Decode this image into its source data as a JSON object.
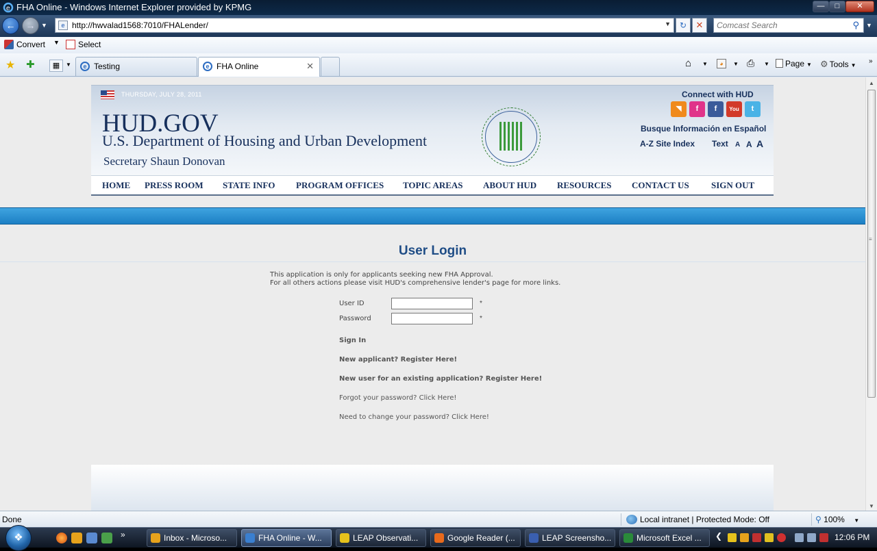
{
  "window": {
    "title": "FHA Online - Windows Internet Explorer provided by KPMG"
  },
  "address": {
    "url": "http://hwvalad1568:7010/FHALender/"
  },
  "search": {
    "placeholder": "Comcast Search"
  },
  "toolbar": {
    "convert_label": "Convert",
    "select_label": "Select"
  },
  "tabs": [
    {
      "label": "Testing"
    },
    {
      "label": "FHA Online",
      "active": true
    }
  ],
  "command_bar": {
    "page_label": "Page",
    "tools_label": "Tools"
  },
  "hud": {
    "date": "THURSDAY, JULY 28, 2011",
    "logo": "HUD.GOV",
    "department": "U.S. Department of Housing and Urban Development",
    "secretary": "Secretary Shaun Donovan",
    "connect": "Connect with HUD",
    "social": [
      {
        "icon": "rss-icon",
        "glyph": "◥",
        "color": "#f08a1c"
      },
      {
        "icon": "facebook-icon",
        "glyph": "f",
        "color": "#e0348a"
      },
      {
        "icon": "facebook-icon",
        "glyph": "f",
        "color": "#3b5b9a"
      },
      {
        "icon": "youtube-icon",
        "glyph": "You",
        "color": "#d23a2a"
      },
      {
        "icon": "twitter-icon",
        "glyph": "t",
        "color": "#4ab3e6"
      }
    ],
    "spanish": "Busque Información en Español",
    "az_index": "A-Z Site Index",
    "text_label": "Text",
    "text_sizes": [
      "A",
      "A",
      "A"
    ],
    "nav": [
      "HOME",
      "PRESS ROOM",
      "STATE INFO",
      "PROGRAM OFFICES",
      "TOPIC AREAS",
      "ABOUT HUD",
      "RESOURCES",
      "CONTACT US",
      "SIGN OUT"
    ]
  },
  "login": {
    "title": "User Login",
    "info_line1": "This application is only for applicants seeking new FHA Approval.",
    "info_line2": "For all others actions please visit HUD's comprehensive lender's page for more links.",
    "userid_label": "User ID",
    "password_label": "Password",
    "required_mark": "*",
    "userid_value": "",
    "password_value": "",
    "sign_in": "Sign In",
    "new_applicant": "New applicant? Register Here!",
    "new_user": "New user for an existing application? Register Here!",
    "forgot": "Forgot your password? Click Here!",
    "change": "Need to change your password? Click Here!"
  },
  "status": {
    "text": "Done",
    "zone": "Local intranet | Protected Mode: Off",
    "zoom": "100%"
  },
  "taskbar": {
    "buttons": [
      {
        "label": "Inbox - Microso...",
        "color": "#e6a21c"
      },
      {
        "label": "FHA Online - W...",
        "color": "#3a7fd0",
        "active": true
      },
      {
        "label": "LEAP Observati...",
        "color": "#e6c21c"
      },
      {
        "label": "Google Reader (...",
        "color": "#e86a1c"
      },
      {
        "label": "LEAP Screensho...",
        "color": "#3a5fb0"
      },
      {
        "label": "Microsoft Excel ...",
        "color": "#2a8a3a"
      }
    ],
    "clock": "12:06 PM"
  }
}
